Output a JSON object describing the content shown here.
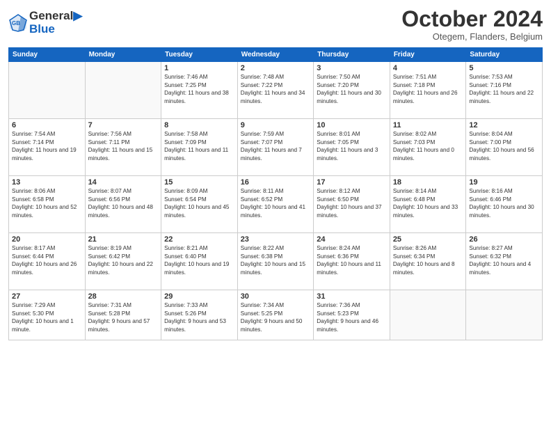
{
  "header": {
    "logo_line1": "General",
    "logo_line2": "Blue",
    "month": "October 2024",
    "location": "Otegem, Flanders, Belgium"
  },
  "weekdays": [
    "Sunday",
    "Monday",
    "Tuesday",
    "Wednesday",
    "Thursday",
    "Friday",
    "Saturday"
  ],
  "weeks": [
    [
      {
        "day": "",
        "info": ""
      },
      {
        "day": "",
        "info": ""
      },
      {
        "day": "1",
        "info": "Sunrise: 7:46 AM\nSunset: 7:25 PM\nDaylight: 11 hours and 38 minutes."
      },
      {
        "day": "2",
        "info": "Sunrise: 7:48 AM\nSunset: 7:22 PM\nDaylight: 11 hours and 34 minutes."
      },
      {
        "day": "3",
        "info": "Sunrise: 7:50 AM\nSunset: 7:20 PM\nDaylight: 11 hours and 30 minutes."
      },
      {
        "day": "4",
        "info": "Sunrise: 7:51 AM\nSunset: 7:18 PM\nDaylight: 11 hours and 26 minutes."
      },
      {
        "day": "5",
        "info": "Sunrise: 7:53 AM\nSunset: 7:16 PM\nDaylight: 11 hours and 22 minutes."
      }
    ],
    [
      {
        "day": "6",
        "info": "Sunrise: 7:54 AM\nSunset: 7:14 PM\nDaylight: 11 hours and 19 minutes."
      },
      {
        "day": "7",
        "info": "Sunrise: 7:56 AM\nSunset: 7:11 PM\nDaylight: 11 hours and 15 minutes."
      },
      {
        "day": "8",
        "info": "Sunrise: 7:58 AM\nSunset: 7:09 PM\nDaylight: 11 hours and 11 minutes."
      },
      {
        "day": "9",
        "info": "Sunrise: 7:59 AM\nSunset: 7:07 PM\nDaylight: 11 hours and 7 minutes."
      },
      {
        "day": "10",
        "info": "Sunrise: 8:01 AM\nSunset: 7:05 PM\nDaylight: 11 hours and 3 minutes."
      },
      {
        "day": "11",
        "info": "Sunrise: 8:02 AM\nSunset: 7:03 PM\nDaylight: 11 hours and 0 minutes."
      },
      {
        "day": "12",
        "info": "Sunrise: 8:04 AM\nSunset: 7:00 PM\nDaylight: 10 hours and 56 minutes."
      }
    ],
    [
      {
        "day": "13",
        "info": "Sunrise: 8:06 AM\nSunset: 6:58 PM\nDaylight: 10 hours and 52 minutes."
      },
      {
        "day": "14",
        "info": "Sunrise: 8:07 AM\nSunset: 6:56 PM\nDaylight: 10 hours and 48 minutes."
      },
      {
        "day": "15",
        "info": "Sunrise: 8:09 AM\nSunset: 6:54 PM\nDaylight: 10 hours and 45 minutes."
      },
      {
        "day": "16",
        "info": "Sunrise: 8:11 AM\nSunset: 6:52 PM\nDaylight: 10 hours and 41 minutes."
      },
      {
        "day": "17",
        "info": "Sunrise: 8:12 AM\nSunset: 6:50 PM\nDaylight: 10 hours and 37 minutes."
      },
      {
        "day": "18",
        "info": "Sunrise: 8:14 AM\nSunset: 6:48 PM\nDaylight: 10 hours and 33 minutes."
      },
      {
        "day": "19",
        "info": "Sunrise: 8:16 AM\nSunset: 6:46 PM\nDaylight: 10 hours and 30 minutes."
      }
    ],
    [
      {
        "day": "20",
        "info": "Sunrise: 8:17 AM\nSunset: 6:44 PM\nDaylight: 10 hours and 26 minutes."
      },
      {
        "day": "21",
        "info": "Sunrise: 8:19 AM\nSunset: 6:42 PM\nDaylight: 10 hours and 22 minutes."
      },
      {
        "day": "22",
        "info": "Sunrise: 8:21 AM\nSunset: 6:40 PM\nDaylight: 10 hours and 19 minutes."
      },
      {
        "day": "23",
        "info": "Sunrise: 8:22 AM\nSunset: 6:38 PM\nDaylight: 10 hours and 15 minutes."
      },
      {
        "day": "24",
        "info": "Sunrise: 8:24 AM\nSunset: 6:36 PM\nDaylight: 10 hours and 11 minutes."
      },
      {
        "day": "25",
        "info": "Sunrise: 8:26 AM\nSunset: 6:34 PM\nDaylight: 10 hours and 8 minutes."
      },
      {
        "day": "26",
        "info": "Sunrise: 8:27 AM\nSunset: 6:32 PM\nDaylight: 10 hours and 4 minutes."
      }
    ],
    [
      {
        "day": "27",
        "info": "Sunrise: 7:29 AM\nSunset: 5:30 PM\nDaylight: 10 hours and 1 minute."
      },
      {
        "day": "28",
        "info": "Sunrise: 7:31 AM\nSunset: 5:28 PM\nDaylight: 9 hours and 57 minutes."
      },
      {
        "day": "29",
        "info": "Sunrise: 7:33 AM\nSunset: 5:26 PM\nDaylight: 9 hours and 53 minutes."
      },
      {
        "day": "30",
        "info": "Sunrise: 7:34 AM\nSunset: 5:25 PM\nDaylight: 9 hours and 50 minutes."
      },
      {
        "day": "31",
        "info": "Sunrise: 7:36 AM\nSunset: 5:23 PM\nDaylight: 9 hours and 46 minutes."
      },
      {
        "day": "",
        "info": ""
      },
      {
        "day": "",
        "info": ""
      }
    ]
  ]
}
